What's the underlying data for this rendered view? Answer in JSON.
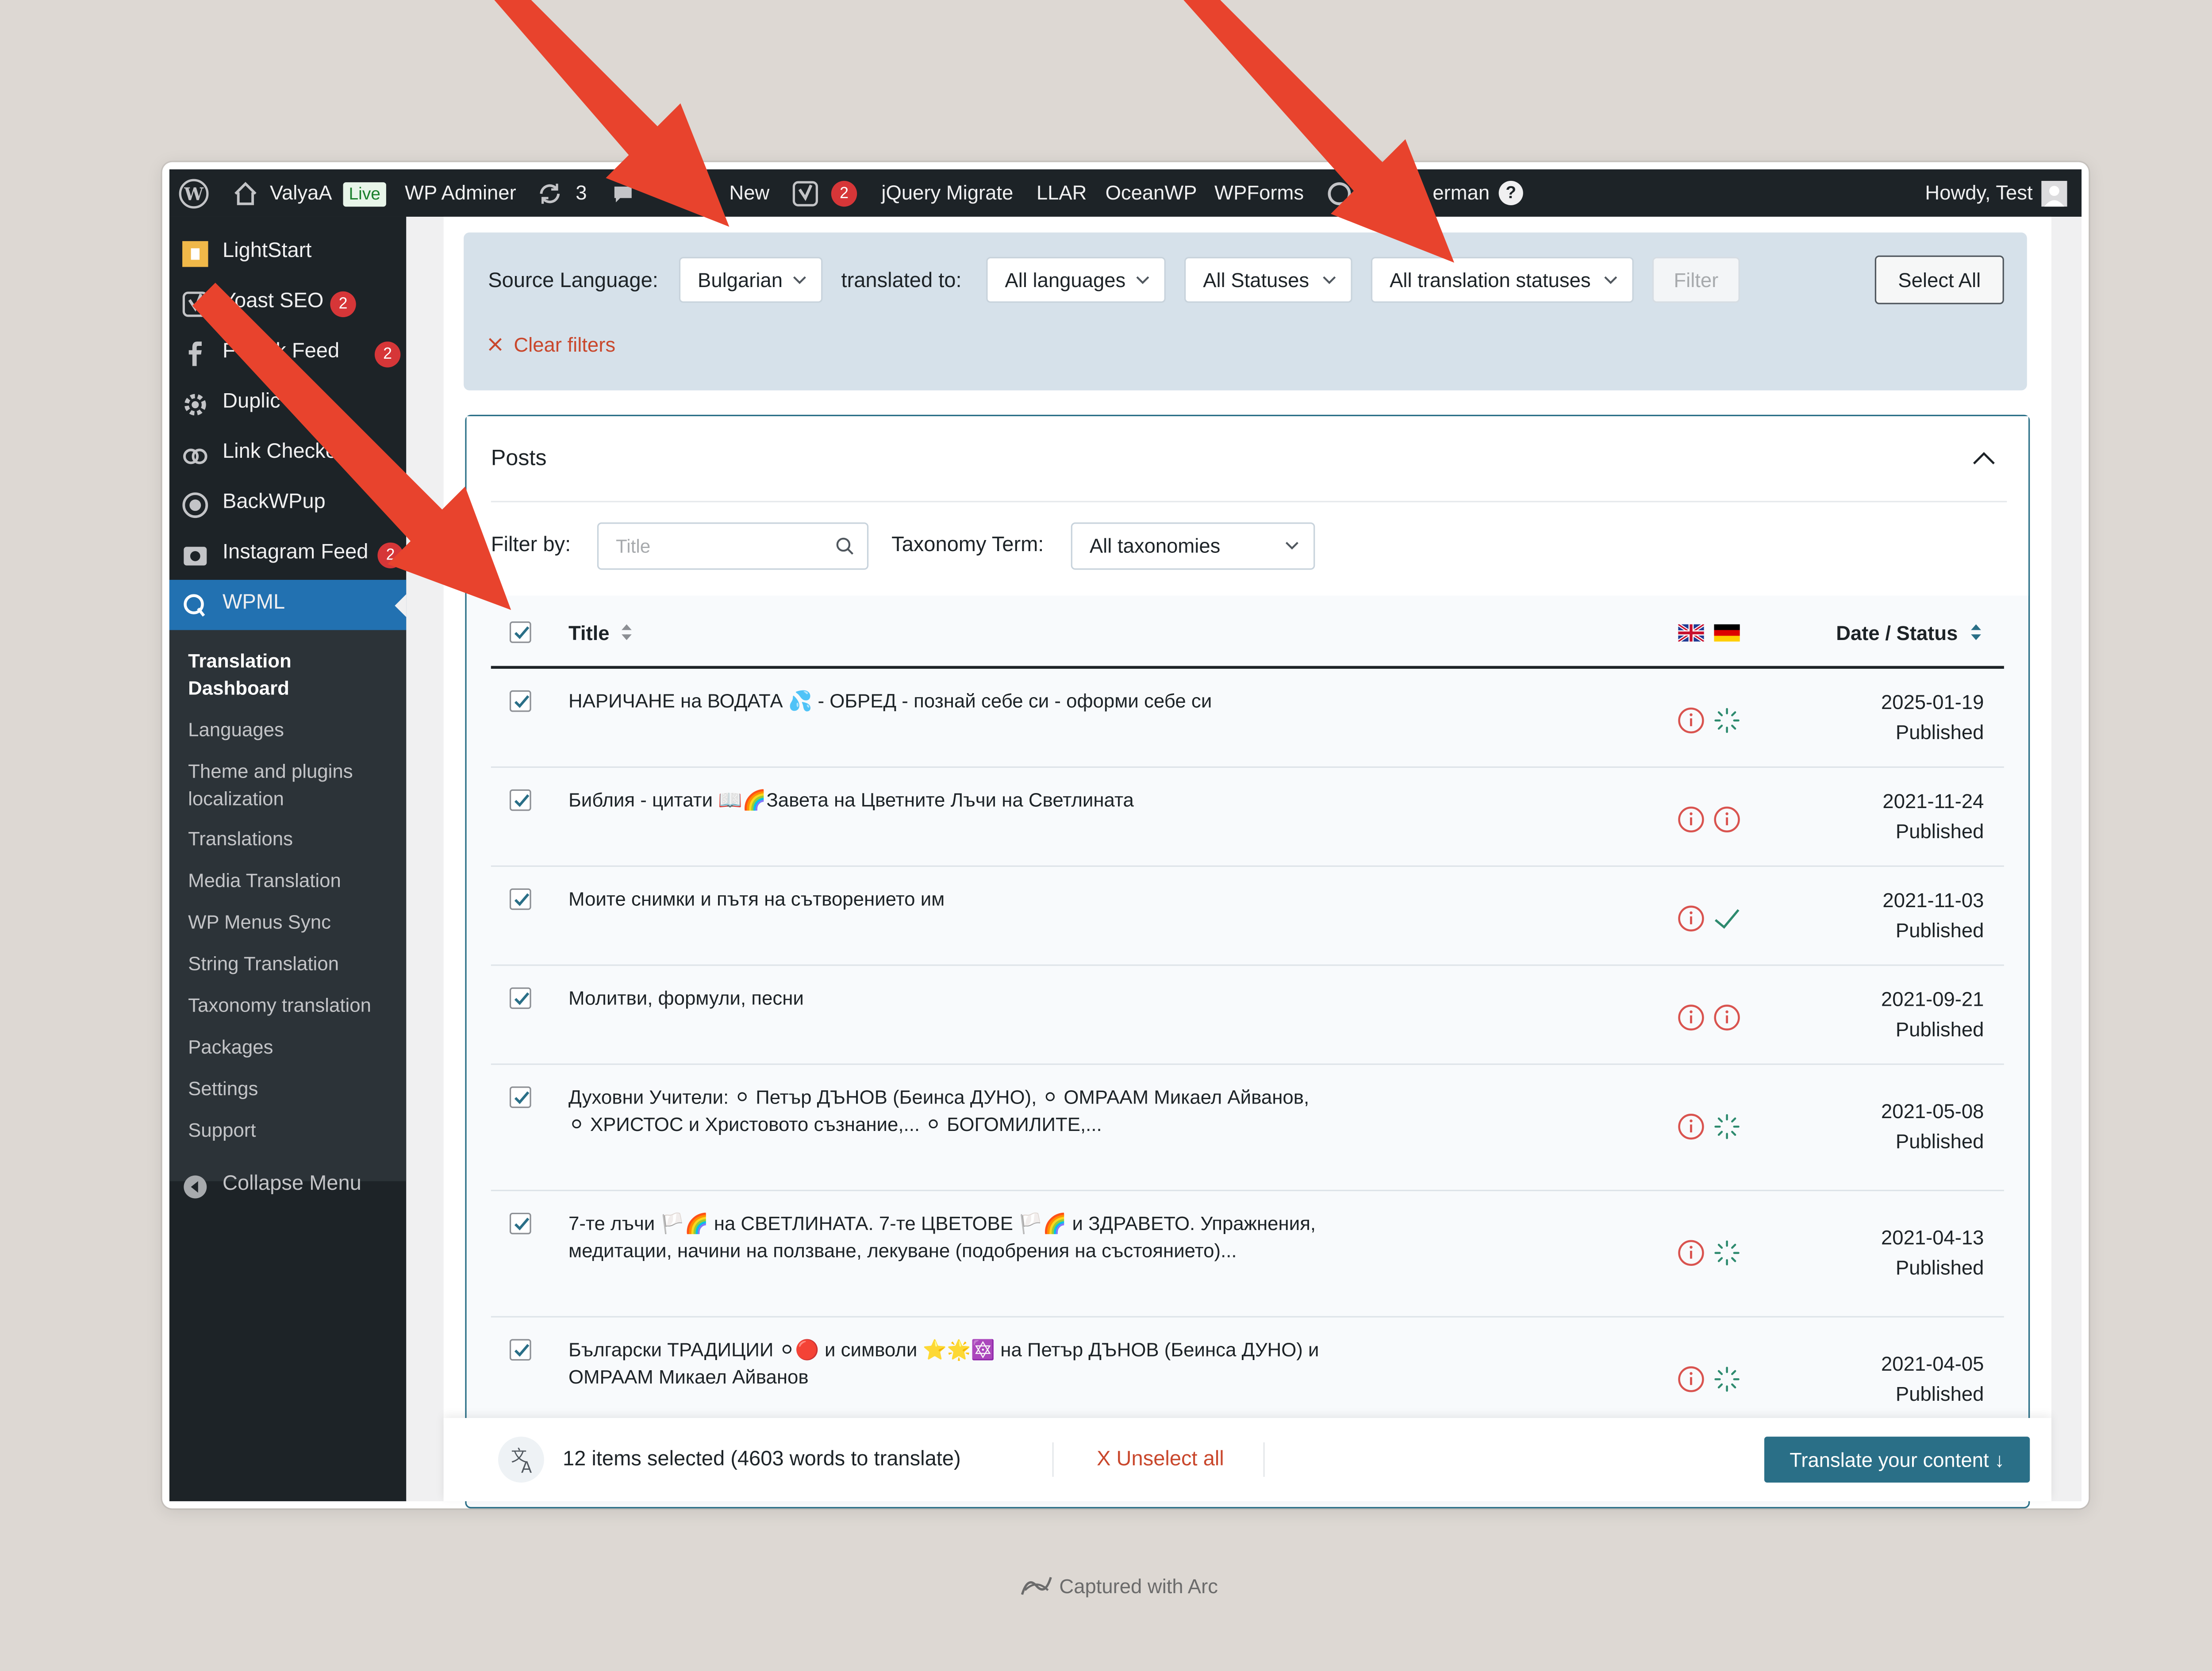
{
  "adminbar": {
    "site_name": "ValyaA",
    "live_badge": "Live",
    "wp_adminer": "WP Adminer",
    "updates_count": "3",
    "new_label": "New",
    "yoast_count": "2",
    "jquery_migrate": "jQuery Migrate",
    "llar": "LLAR",
    "oceanwp": "OceanWP",
    "wpforms": "WPForms",
    "language_partial": "erman",
    "help": "?",
    "howdy": "Howdy, Test"
  },
  "sidebar": {
    "items": [
      {
        "label": "LightStart",
        "icon": "lightstart-icon"
      },
      {
        "label": "Yoast SEO",
        "badge": "2",
        "icon": "yoast-icon"
      },
      {
        "label": "F    book Feed",
        "badge": "2",
        "icon": "facebook-icon"
      },
      {
        "label": "Duplic    r Pro",
        "icon": "duplicator-icon"
      },
      {
        "label": "Link Checke",
        "icon": "link-checker-icon"
      },
      {
        "label": "BackWPup",
        "icon": "backwpup-icon"
      },
      {
        "label": "Instagram Feed",
        "badge": "2",
        "icon": "instagram-icon"
      },
      {
        "label": "WPML",
        "icon": "wpml-icon"
      }
    ],
    "submenu": [
      "Translation Dashboard",
      "Languages",
      "Theme and plugins localization",
      "Translations",
      "Media Translation",
      "WP Menus Sync",
      "String Translation",
      "Taxonomy translation",
      "Packages",
      "Settings",
      "Support"
    ],
    "collapse": "Collapse Menu"
  },
  "filters": {
    "source_label": "Source Language:",
    "source_value": "Bulgarian",
    "translated_to_label": "translated to:",
    "translated_to_value": "All languages",
    "status_value": "All Statuses",
    "translation_status_value": "All translation statuses",
    "filter_button": "Filter",
    "select_all": "Select All",
    "clear_filters": "Clear filters"
  },
  "posts": {
    "heading": "Posts",
    "filter_by_label": "Filter by:",
    "title_placeholder": "Title",
    "taxonomy_label": "Taxonomy Term:",
    "taxonomy_value": "All taxonomies",
    "col_title": "Title",
    "col_date_status": "Date / Status",
    "rows": [
      {
        "line1": "НАРИЧАНЕ на ВОДАТА 💦 - ОБРЕД - познай себе си - оформи себе си",
        "line2": "",
        "date": "2025-01-19",
        "status": "Published",
        "de_status": "in-progress"
      },
      {
        "line1": "Библия - цитати 📖🌈Завета на Цветните Лъчи на Светлината",
        "line2": "",
        "date": "2021-11-24",
        "status": "Published",
        "de_status": "needs-update"
      },
      {
        "line1": "Моите снимки и пътя на сътворението им",
        "line2": "",
        "date": "2021-11-03",
        "status": "Published",
        "de_status": "complete"
      },
      {
        "line1": "Молитви, формули, песни",
        "line2": "",
        "date": "2021-09-21",
        "status": "Published",
        "de_status": "needs-update"
      },
      {
        "line1": "Духовни Учители: ⚪ Петър ДЪНОВ (Беинса ДУНО), ⚪ ОМРААМ Микаел Айванов,",
        "line2": "⚪ ХРИСТОС и Христовото съзнание,... ⚪ БОГОМИЛИТЕ,...",
        "date": "2021-05-08",
        "status": "Published",
        "de_status": "in-progress"
      },
      {
        "line1": "7-те лъчи 🏳️🌈 на СВЕТЛИНАТА. 7-те ЦВЕТОВЕ 🏳️🌈 и ЗДРАВЕТО. Упражнения,",
        "line2": "медитации, начини на ползване, лекуване (подобрения на състоянието)...",
        "date": "2021-04-13",
        "status": "Published",
        "de_status": "in-progress"
      },
      {
        "line1": "Български ТРАДИЦИИ ⚪🔴 и символи ⭐🌟🔯 на Петър ДЪНОВ (Беинса ДУНО) и",
        "line2": "ОМРААМ Микаел Айванов",
        "date": "2021-04-05",
        "status": "Published",
        "de_status": "in-progress"
      }
    ]
  },
  "bottombar": {
    "selected_text": "12 items selected (4603 words to translate)",
    "unselect_all": "X Unselect all",
    "translate_button": "Translate your content ↓"
  },
  "footer": {
    "captured": "Captured with Arc"
  },
  "colors": {
    "admin_dark": "#1d2327",
    "wp_blue": "#2271b1",
    "wpml_teal": "#2a6f87",
    "annotation_red": "#e8432d",
    "status_red": "#d9534f",
    "status_green": "#2d8a6e"
  }
}
